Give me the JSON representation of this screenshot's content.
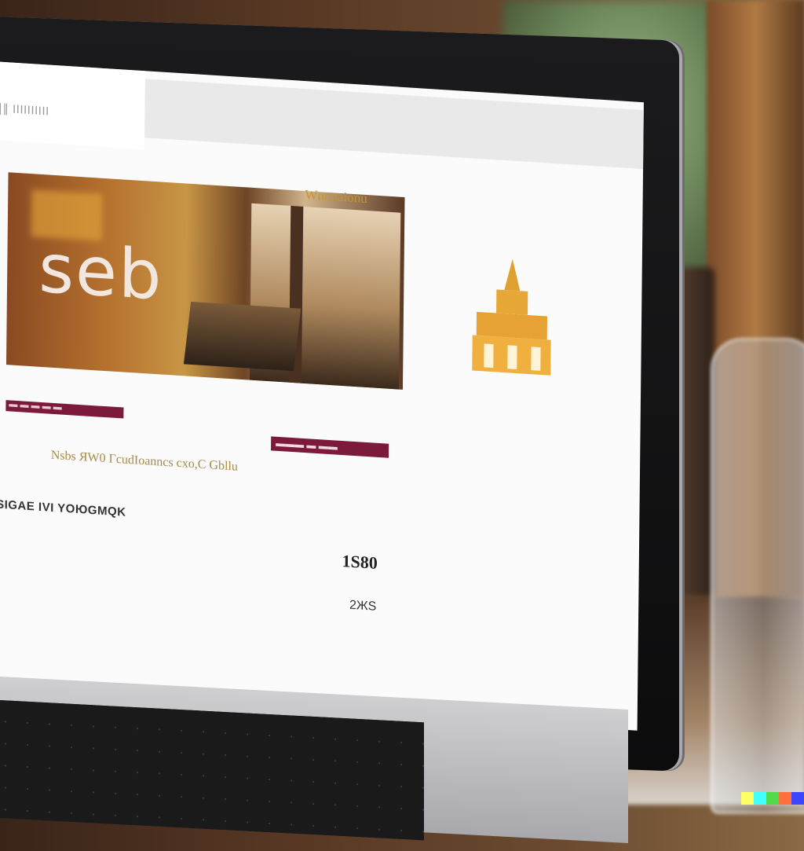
{
  "site": {
    "name": "∥∥ ΙΙΙΙΙΙΙΙΙΙ"
  },
  "hero": {
    "text": "seb"
  },
  "promo": {
    "title": "Wnnnaionu"
  },
  "tags": {
    "left_label": "▬ ▬ ▬ ▬ ▬",
    "right_label": "▬▬▬ ▬ ▬▬"
  },
  "tagline": "Nsbs ЯW0 ГcudIoanncs cxo,C Gbllu",
  "nav": {
    "link": "ЧSIGAE IVI YOЮGMQK"
  },
  "product": {
    "price": "1S80",
    "qty": "2ЖS"
  },
  "colors": {
    "accent_gold": "#c8962b",
    "tag_burgundy": "#7b1a3a"
  }
}
